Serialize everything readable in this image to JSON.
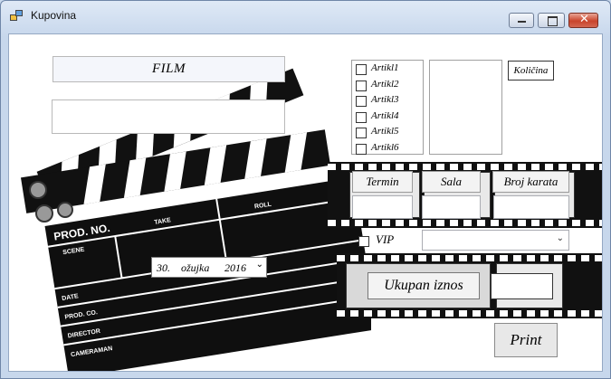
{
  "window": {
    "title": "Kupovina"
  },
  "film_label": "FILM",
  "film_input_value": "",
  "checklist": [
    "Artikl1",
    "Artikl2",
    "Artikl3",
    "Artikl4",
    "Artikl5",
    "Artikl6"
  ],
  "kolicina_label": "Količina",
  "termin_label": "Termin",
  "sala_label": "Sala",
  "broj_karata_label": "Broj karata",
  "vip_label": "VIP",
  "date_picker": {
    "day": "30.",
    "month": "ožujka",
    "year": "2016"
  },
  "clapper": {
    "prod_no": "PROD. NO.",
    "scene": "SCENE",
    "take": "TAKE",
    "roll": "ROLL",
    "date": "DATE",
    "prod_co": "PROD. CO.",
    "director": "DIRECTOR",
    "cameraman": "CAMERAMAN"
  },
  "ukupan_iznos_label": "Ukupan iznos",
  "print_label": "Print"
}
